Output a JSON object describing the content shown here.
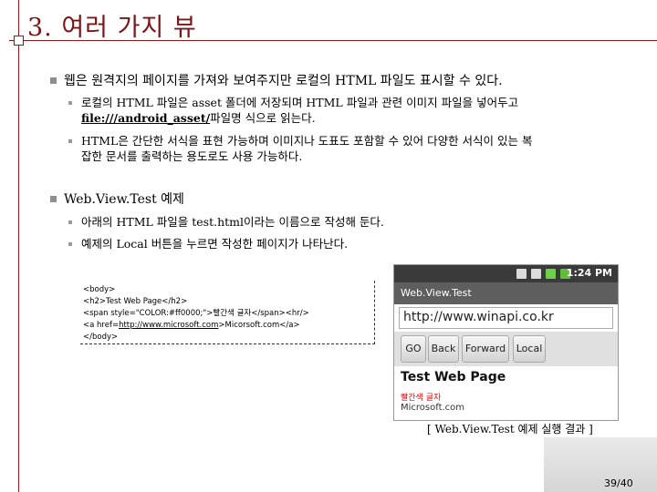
{
  "title": "3. 여러 가지 뷰",
  "section1": {
    "heading": "웹은 원격지의 페이지를 가져와 보여주지만 로컬의 HTML 파일도 표시할 수 있다.",
    "sub1_line1": "로컬의 HTML 파일은 asset 폴더에 저장되며 HTML 파일과 관련 이미지 파일을 넣어두고",
    "sub1_link": "file:///android_asset/",
    "sub1_line2_rest": "파일명 식으로 읽는다.",
    "sub2_line1": "HTML은 간단한 서식을 표현 가능하며 이미지나 도표도 포함할 수 있어 다양한 서식이 있는 복",
    "sub2_line2": "잡한 문서를 출력하는 용도로도 사용 가능하다."
  },
  "section2": {
    "heading": "Web.View.Test 예제",
    "sub1": "아래의 HTML 파일을 test.html이라는 이름으로 작성해 둔다.",
    "sub2": "예제의 Local 버튼을 누르면 작성한 페이지가 나타난다."
  },
  "code": {
    "l1": "<body>",
    "l2": "<h2>Test Web Page</h2>",
    "l3": "<span style=\"COLOR:#ff0000;\">빨간색 글자</span><hr/>",
    "l4_pre": "<a href=",
    "l4_link": "http://www.microsoft.com",
    "l4_post": ">Micorsoft.com</a>",
    "l5": "</body>"
  },
  "phone": {
    "time": "1:24 PM",
    "app_title": "Web.View.Test",
    "url": "http://www.winapi.co.kr",
    "buttons": [
      "GO",
      "Back",
      "Forward",
      "Local"
    ],
    "page_heading": "Test Web Page",
    "red_text": "빨간색 글자",
    "link_text": "Microsoft.com"
  },
  "caption": "[ Web.View.Test 예제 실행 결과 ]",
  "page_number": "39/40",
  "colors": {
    "accent": "#7a1518",
    "red": "#ff0000"
  }
}
